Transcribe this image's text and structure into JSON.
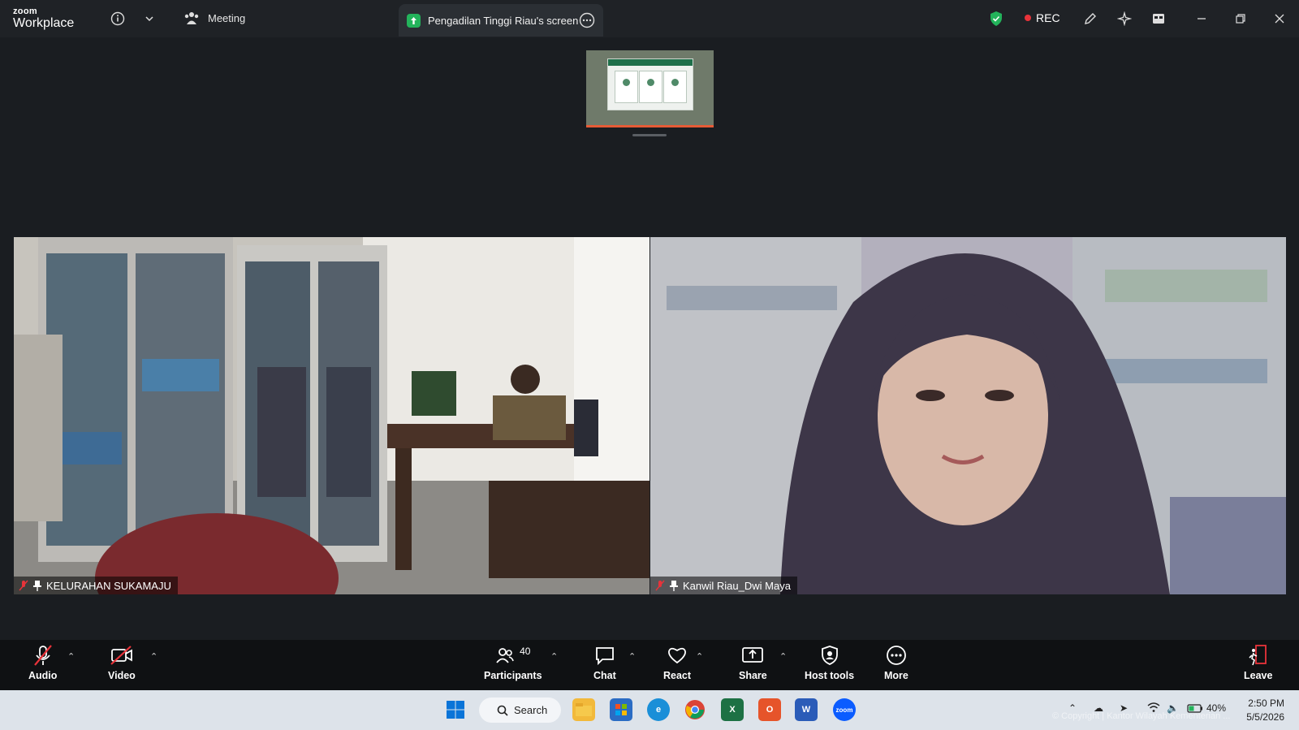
{
  "app": {
    "logo_small": "zoom",
    "logo_big": "Workplace",
    "meeting_label": "Meeting",
    "shared_screen_tab": "Pengadilan Tinggi Riau's screen",
    "rec_label": "REC"
  },
  "video_tiles": [
    {
      "name": "KELURAHAN SUKAMAJU",
      "muted": true,
      "pinned": true
    },
    {
      "name": "Kanwil Riau_Dwi Maya",
      "muted": true,
      "pinned": true
    }
  ],
  "toolbar": {
    "audio": "Audio",
    "video": "Video",
    "participants": "Participants",
    "participants_count": "40",
    "chat": "Chat",
    "react": "React",
    "share": "Share",
    "host_tools": "Host tools",
    "more": "More",
    "leave": "Leave"
  },
  "taskbar": {
    "search_label": "Search",
    "battery": "40%",
    "time": "2:50 PM",
    "date": "5/5/2026",
    "apps": [
      "file-explorer",
      "microsoft-store",
      "edge",
      "chrome",
      "excel",
      "office",
      "word",
      "zoom"
    ]
  },
  "watermark": "© Copyright | Kantor Wilayah Kementerian ...",
  "colors": {
    "accent_green": "#23b35b",
    "rec_red": "#e8333a",
    "toolbar_bg": "#0f1113",
    "taskbar_bg": "#dde3ea",
    "leave_red": "#e8333a"
  }
}
